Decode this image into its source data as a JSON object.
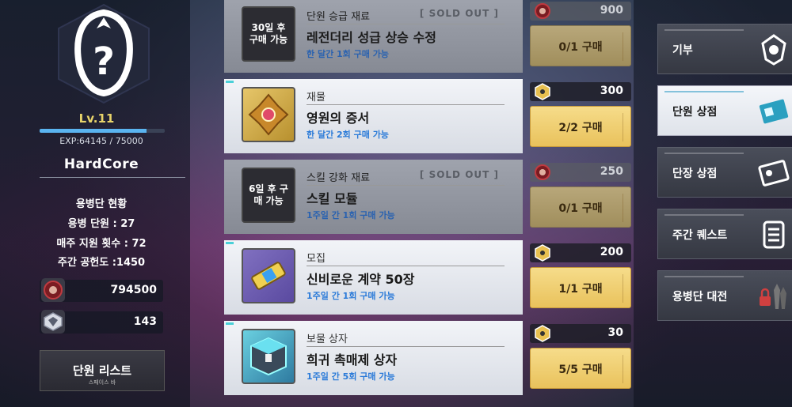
{
  "player": {
    "level": "Lv.11",
    "exp_text": "EXP:64145 / 75000",
    "exp_fraction": 0.855,
    "name": "HardCore"
  },
  "stats": {
    "title": "용병단 현황",
    "members": "용병 단원 : 27",
    "weekly_support": "매주 지원 횟수 : 72",
    "weekly_contribution": "주간 공헌도 :1450"
  },
  "currencies": [
    {
      "icon": "red-medal-icon",
      "value": "794500"
    },
    {
      "icon": "silver-badge-icon",
      "value": "143"
    }
  ],
  "member_list_button": {
    "label": "단원 리스트",
    "sub": "스페이스 바"
  },
  "shop_items": [
    {
      "category": "단원 승급 재료",
      "name": "레전더리 성급 상승 수정",
      "limit": "한 달간 1회 구매 가능",
      "locked_text": "30일 후 구매 가능",
      "sold_out": "[ SOLD OUT ]",
      "price": "900",
      "buy": "0/1 구매",
      "available": false
    },
    {
      "category": "재물",
      "name": "영원의 증서",
      "limit": "한 달간 2회 구매 가능",
      "locked_text": "",
      "sold_out": "",
      "price": "300",
      "buy": "2/2 구매",
      "available": true,
      "thumb": "gold-emblem-icon"
    },
    {
      "category": "스킬 강화 재료",
      "name": "스킬 모듈",
      "limit": "1주일 간 1회 구매 가능",
      "locked_text": "6일 후 구매 가능",
      "sold_out": "[ SOLD OUT ]",
      "price": "250",
      "buy": "0/1 구매",
      "available": false
    },
    {
      "category": "모집",
      "name": "신비로운 계약 50장",
      "limit": "1주일 간 1회 구매 가능",
      "locked_text": "",
      "sold_out": "",
      "price": "200",
      "buy": "1/1 구매",
      "available": true,
      "thumb": "contract-ticket-icon"
    },
    {
      "category": "보물 상자",
      "name": "희귀 촉매제 상자",
      "limit": "1주일 간 5회 구매 가능",
      "locked_text": "",
      "sold_out": "",
      "price": "30",
      "buy": "5/5 구매",
      "available": true,
      "thumb": "treasure-box-icon"
    }
  ],
  "menu": [
    {
      "label": "기부",
      "icon": "donation-crest-icon",
      "active": false
    },
    {
      "label": "단원 상점",
      "icon": "member-card-icon",
      "active": true
    },
    {
      "label": "단장 상점",
      "icon": "leader-card-icon",
      "active": false
    },
    {
      "label": "주간 퀘스트",
      "icon": "checklist-icon",
      "active": false
    },
    {
      "label": "용병단 대전",
      "icon": "locked-battle-icon",
      "active": false
    }
  ],
  "colors": {
    "accent_gold": "#e8d46a",
    "limit_blue": "#2a7ad8",
    "buy_gold": "#f6dc8a",
    "exp_blue": "#5ab4f0"
  }
}
